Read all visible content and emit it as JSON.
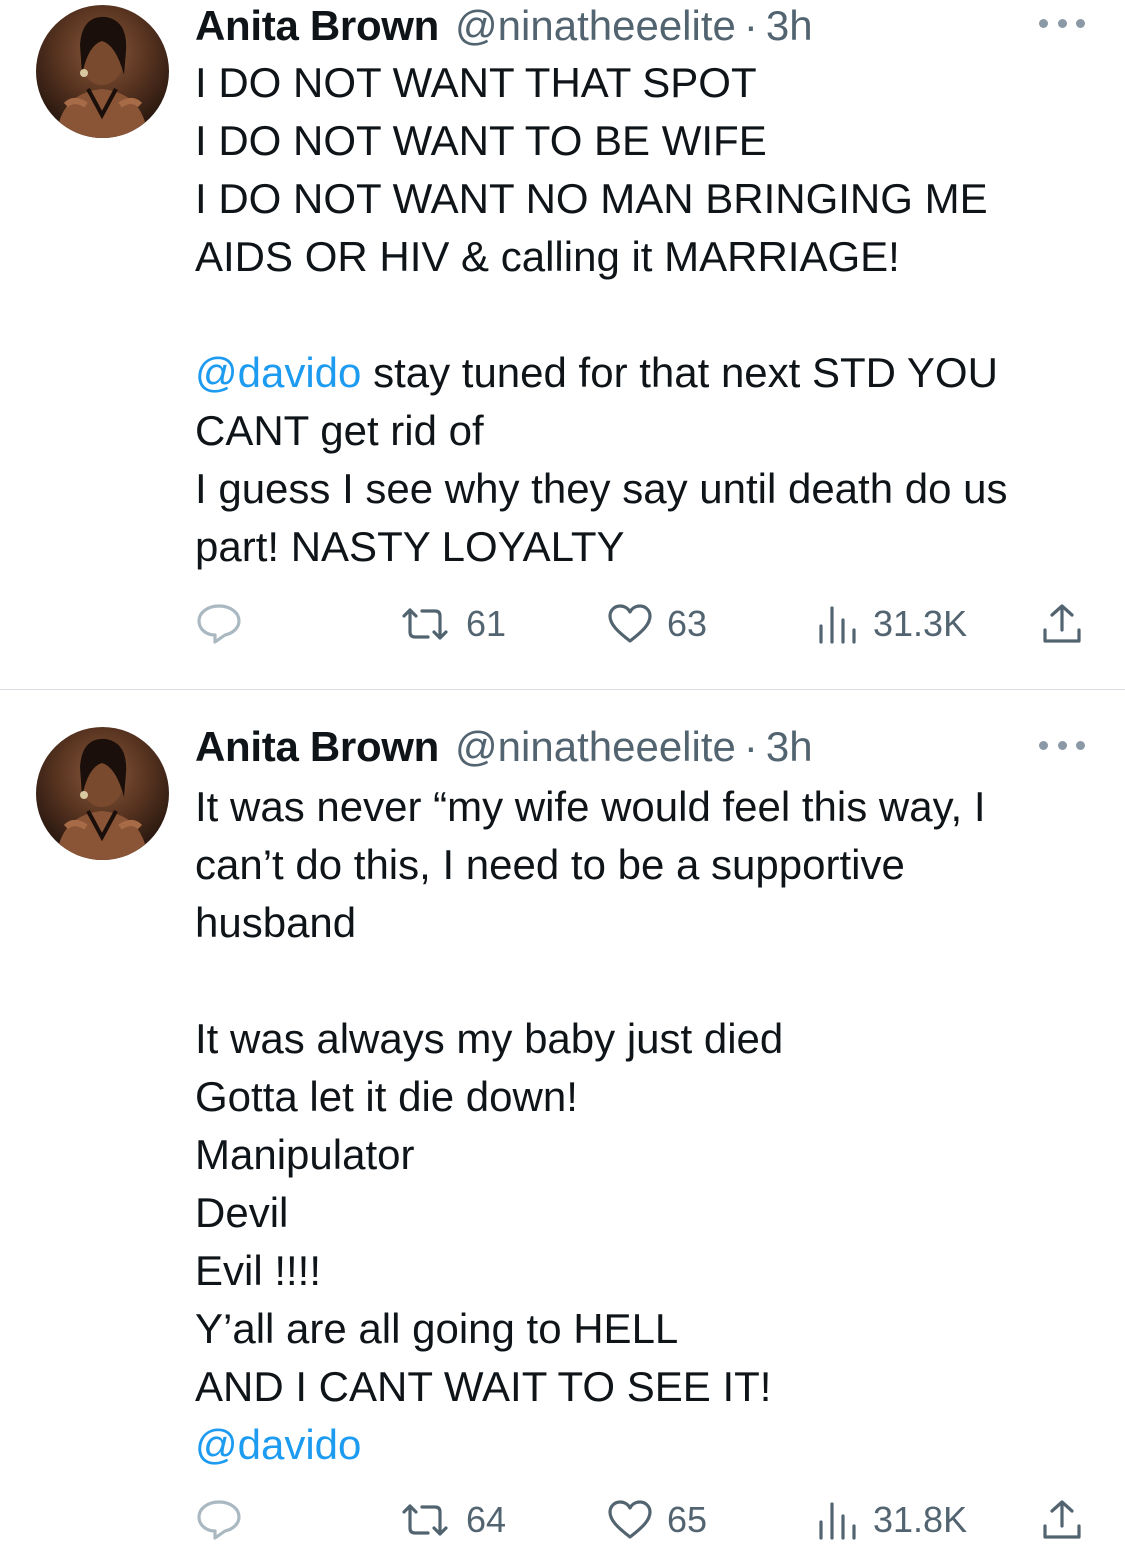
{
  "colors": {
    "text": "#0f1419",
    "muted": "#536471",
    "link": "#1d9bf0",
    "divider": "#d9dde1"
  },
  "tweets": [
    {
      "author_name": "Anita Brown",
      "handle": "@ninatheeelite",
      "separator": "·",
      "time": "3h",
      "lines_1": "I DO NOT WANT THAT SPOT\nI DO NOT WANT TO BE WIFE\nI DO NOT WANT NO MAN BRINGING ME\nAIDS OR HIV & calling it MARRIAGE!\n\n",
      "mention": "@davido",
      "lines_2": " stay tuned for that next STD YOU\nCANT get rid of\nI guess I see why they say until death do us\npart! NASTY LOYALTY",
      "replies": "",
      "retweets": "61",
      "likes": "63",
      "views": "31.3K",
      "icons": [
        "reply-icon",
        "retweet-icon",
        "heart-icon",
        "views-icon",
        "share-icon",
        "more-icon"
      ]
    },
    {
      "author_name": "Anita Brown",
      "handle": "@ninatheeelite",
      "separator": "·",
      "time": "3h",
      "lines_1": "It was never “my wife would feel this way, I\ncan’t do this, I need to be a supportive\nhusband\n\nIt was always my baby just died\nGotta let it die down!\nManipulator\nDevil\nEvil !!!!\nY’all are all going to HELL\nAND I CANT WAIT TO SEE IT!\n",
      "mention": "@davido",
      "lines_2": "",
      "replies": "",
      "retweets": "64",
      "likes": "65",
      "views": "31.8K",
      "icons": [
        "reply-icon",
        "retweet-icon",
        "heart-icon",
        "views-icon",
        "share-icon",
        "more-icon"
      ]
    }
  ]
}
